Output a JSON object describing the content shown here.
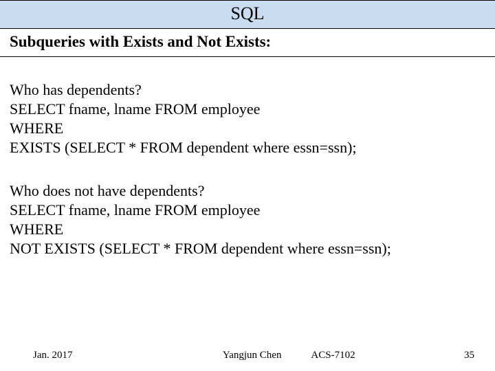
{
  "title": "SQL",
  "heading": "Subqueries with Exists and Not Exists:",
  "block1": {
    "q": "Who has dependents?",
    "l1": "SELECT fname, lname FROM employee",
    "l2": "WHERE",
    "l3": "EXISTS (SELECT * FROM dependent where essn=ssn);"
  },
  "block2": {
    "q": "Who does not have dependents?",
    "l1": "SELECT fname, lname FROM employee",
    "l2": "WHERE",
    "l3": "NOT EXISTS (SELECT * FROM dependent where essn=ssn);"
  },
  "footer": {
    "date": "Jan. 2017",
    "author": "Yangjun Chen",
    "course": "ACS-7102",
    "page": "35"
  }
}
